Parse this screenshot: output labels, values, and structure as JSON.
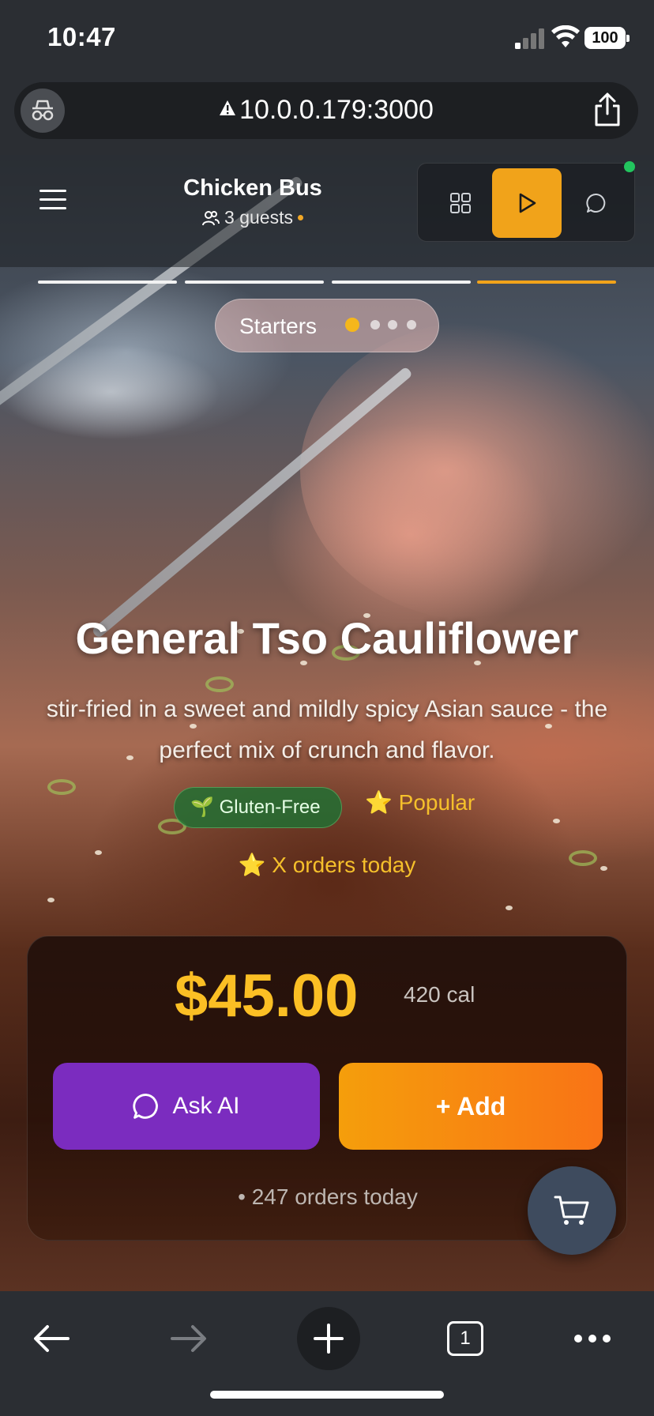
{
  "status_bar": {
    "time": "10:47",
    "battery": "100"
  },
  "browser": {
    "url": "10.0.0.179:3000",
    "tab_count": "1"
  },
  "header": {
    "restaurant_name": "Chicken Bus",
    "guests": "3 guests"
  },
  "progress": {
    "segments": 4,
    "active_segment": 4
  },
  "category": {
    "label": "Starters",
    "dots": 4,
    "active_dot": 1
  },
  "dish": {
    "title": "General Tso Cauliflower",
    "description": "stir-fried in a sweet and mildly spicy Asian sauce - the perfect mix of crunch and flavor.",
    "badges": {
      "diet_icon": "🌱",
      "diet": "Gluten-Free",
      "popular_icon": "⭐",
      "popular": "Popular",
      "orders_icon": "⭐",
      "orders": "X orders today"
    },
    "price": "$45.00",
    "calories": "420 cal",
    "orders_today": "• 247 orders today"
  },
  "actions": {
    "ask_ai": "Ask AI",
    "add": "+ Add"
  },
  "colors": {
    "accent": "#f1a31a",
    "price": "#fbbf24",
    "ask_ai": "#7b2cbf",
    "online": "#22c55e"
  }
}
